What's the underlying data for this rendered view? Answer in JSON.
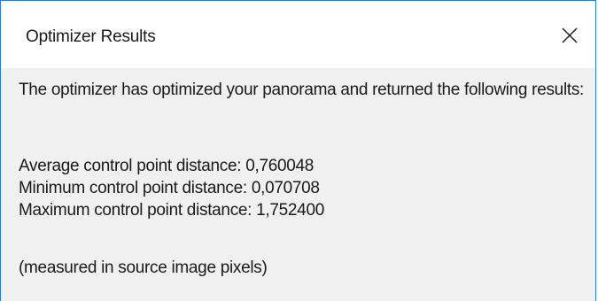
{
  "window": {
    "title": "Optimizer Results",
    "close_icon": "close-icon"
  },
  "message": {
    "intro": "The optimizer has optimized your panorama and returned the following results:",
    "average": "Average control point distance: 0,760048",
    "minimum": "Minimum control point distance: 0,070708",
    "maximum": "Maximum control point distance: 1,752400",
    "note": "(measured in source image pixels)"
  }
}
